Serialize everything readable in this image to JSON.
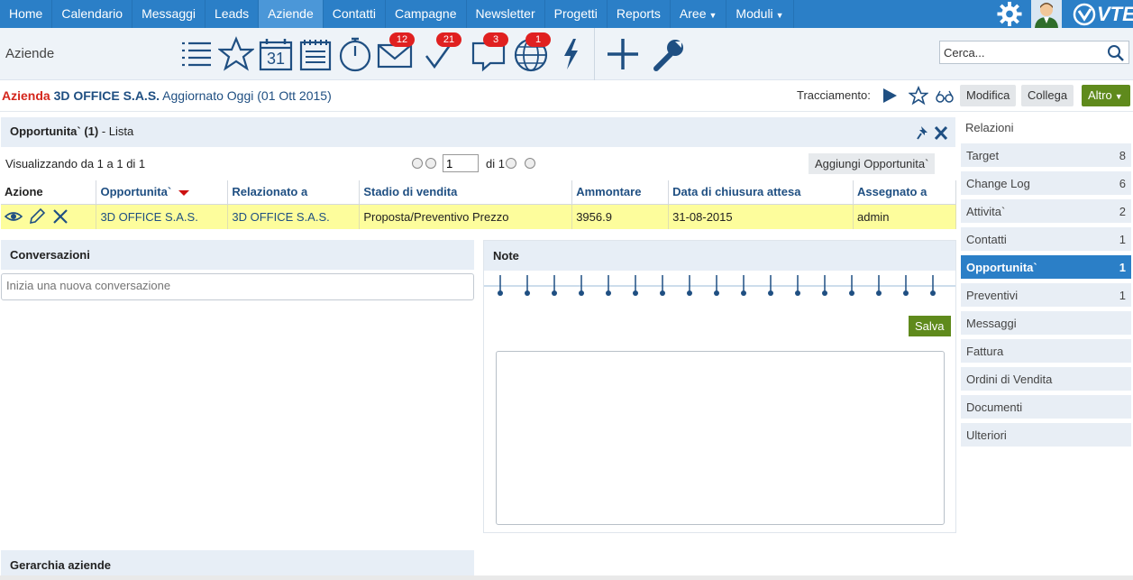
{
  "nav": {
    "items": [
      {
        "label": "Home",
        "active": false,
        "dropdown": false
      },
      {
        "label": "Calendario",
        "active": false,
        "dropdown": false
      },
      {
        "label": "Messaggi",
        "active": false,
        "dropdown": false
      },
      {
        "label": "Leads",
        "active": false,
        "dropdown": false
      },
      {
        "label": "Aziende",
        "active": true,
        "dropdown": false
      },
      {
        "label": "Contatti",
        "active": false,
        "dropdown": false
      },
      {
        "label": "Campagne",
        "active": false,
        "dropdown": false
      },
      {
        "label": "Newsletter",
        "active": false,
        "dropdown": false
      },
      {
        "label": "Progetti",
        "active": false,
        "dropdown": false
      },
      {
        "label": "Reports",
        "active": false,
        "dropdown": false
      },
      {
        "label": "Aree",
        "active": false,
        "dropdown": true
      },
      {
        "label": "Moduli",
        "active": false,
        "dropdown": true
      }
    ],
    "logo_text": "VTE",
    "icons": [
      "gear-icon",
      "user-avatar-icon",
      "vte-logo-icon"
    ]
  },
  "toolbar": {
    "module_title": "Aziende",
    "calendar_day": "31",
    "badges": {
      "messages": "12",
      "tasks": "21",
      "chat": "3",
      "world": "1"
    },
    "search_placeholder": "Cerca..."
  },
  "record": {
    "module": "Azienda",
    "name": "3D OFFICE S.A.S.",
    "updated": "Aggiornato Oggi (01 Ott 2015)",
    "tracking_label": "Tracciamento:",
    "buttons": {
      "edit": "Modifica",
      "link": "Collega",
      "more": "Altro"
    }
  },
  "opportunities": {
    "title": "Opportunita` (1)",
    "subtitle": "- Lista",
    "showing": "Visualizzando da 1 a 1 di 1",
    "page_value": "1",
    "page_total": "di 1",
    "add_button": "Aggiungi Opportunita`",
    "columns": [
      "Azione",
      "Opportunita`",
      "Relazionato a",
      "Stadio di vendita",
      "Ammontare",
      "Data di chiusura attesa",
      "Assegnato a"
    ],
    "rows": [
      {
        "opportunity": "3D OFFICE S.A.S.",
        "related_to": "3D OFFICE S.A.S.",
        "stage": "Proposta/Preventivo Prezzo",
        "amount": "3956.9",
        "close_date": "31-08-2015",
        "assigned": "admin"
      }
    ],
    "row_color": "#fdfd9c"
  },
  "conversations": {
    "title": "Conversazioni",
    "placeholder": "Inizia una nuova conversazione"
  },
  "notes": {
    "title": "Note",
    "save_label": "Salva"
  },
  "hierarchy": {
    "title": "Gerarchia aziende"
  },
  "relations": {
    "title": "Relazioni",
    "items": [
      {
        "label": "Target",
        "count": "8",
        "active": false
      },
      {
        "label": "Change Log",
        "count": "6",
        "active": false
      },
      {
        "label": "Attivita`",
        "count": "2",
        "active": false
      },
      {
        "label": "Contatti",
        "count": "1",
        "active": false
      },
      {
        "label": "Opportunita`",
        "count": "1",
        "active": true
      },
      {
        "label": "Preventivi",
        "count": "1",
        "active": false
      },
      {
        "label": "Messaggi",
        "count": "",
        "active": false
      },
      {
        "label": "Fattura",
        "count": "",
        "active": false
      },
      {
        "label": "Ordini di Vendita",
        "count": "",
        "active": false
      },
      {
        "label": "Documenti",
        "count": "",
        "active": false
      },
      {
        "label": "Ulteriori",
        "count": "",
        "active": false
      }
    ]
  },
  "colors": {
    "nav_blue": "#2b7fc7",
    "accent_green": "#5f8a1c",
    "record_module_red": "#d4261c",
    "link_blue": "#1f4f82",
    "badge_red": "#e02020"
  }
}
